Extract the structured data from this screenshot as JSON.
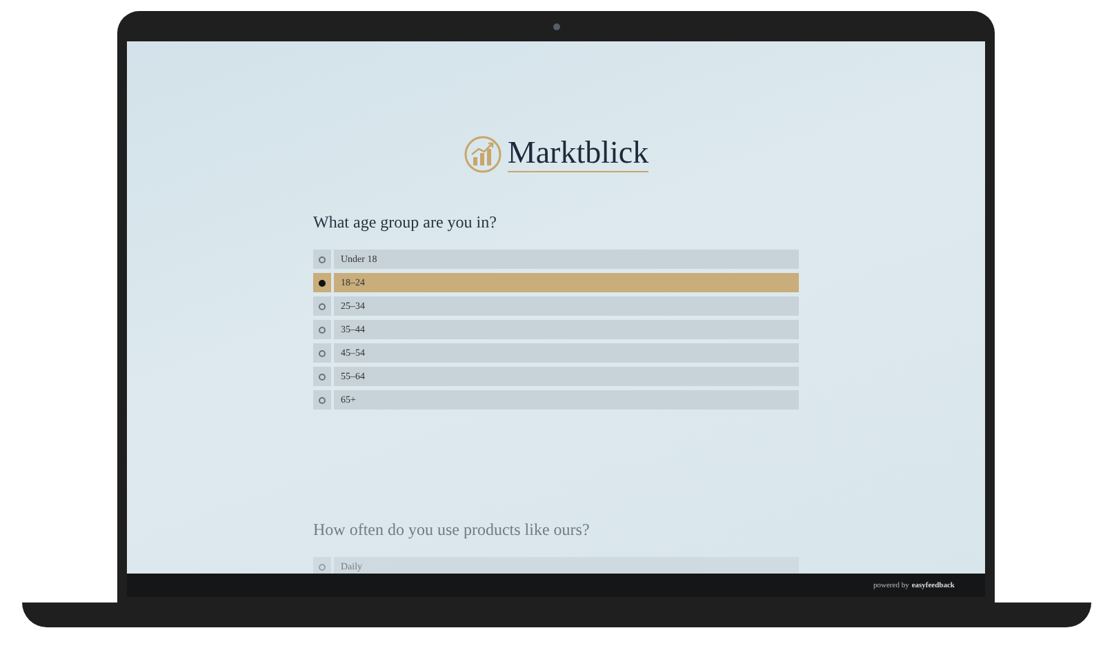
{
  "brand": {
    "name": "Marktblick"
  },
  "questions": [
    {
      "title": "What age group are you in?",
      "active": true,
      "options": [
        {
          "label": "Under 18",
          "selected": false
        },
        {
          "label": "18–24",
          "selected": true
        },
        {
          "label": "25–34",
          "selected": false
        },
        {
          "label": "35–44",
          "selected": false
        },
        {
          "label": "45–54",
          "selected": false
        },
        {
          "label": "55–64",
          "selected": false
        },
        {
          "label": "65+",
          "selected": false
        }
      ]
    },
    {
      "title": "How often do you use products like ours?",
      "active": false,
      "options": [
        {
          "label": "Daily",
          "selected": false
        }
      ]
    }
  ],
  "footer": {
    "prefix": "powered by",
    "brand": "easyfeedback"
  }
}
